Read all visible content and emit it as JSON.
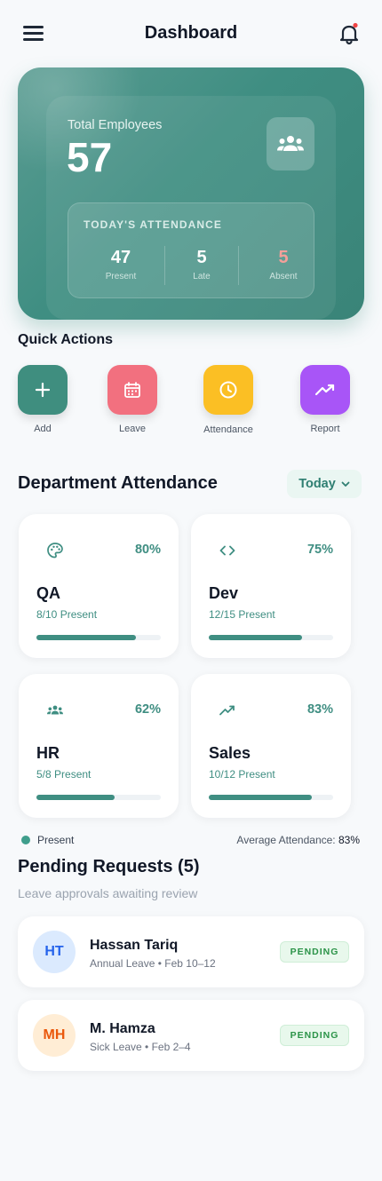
{
  "header": {
    "title": "Dashboard",
    "menu_icon": "hamburger-menu-icon",
    "bell_icon": "bell-icon",
    "notification_dot_color": "#ef4444"
  },
  "hero": {
    "total_label": "Total Employees",
    "total_value": "57",
    "icon": "group-icon",
    "attendance": {
      "title": "TODAY'S ATTENDANCE",
      "present": {
        "value": "47",
        "label": "Present"
      },
      "late": {
        "value": "5",
        "label": "Late"
      },
      "absent": {
        "value": "5",
        "label": "Absent",
        "color": "#f4a09a"
      }
    }
  },
  "quick_actions": {
    "title": "Quick Actions",
    "items": [
      {
        "label": "Add",
        "icon": "plus-icon",
        "color": "#3f8e7f"
      },
      {
        "label": "Leave",
        "icon": "calendar-icon",
        "color": "#f2707f"
      },
      {
        "label": "Attendance",
        "icon": "clock-icon",
        "color": "#fbbf24"
      },
      {
        "label": "Report",
        "icon": "trending-up-icon",
        "color": "#a855f7"
      }
    ]
  },
  "department": {
    "title": "Department Attendance",
    "filter_label": "Today",
    "cards": [
      {
        "name": "QA",
        "percent": "80%",
        "present_text": "8/10 Present",
        "ratio": 0.8,
        "icon": "palette-icon"
      },
      {
        "name": "Dev",
        "percent": "75%",
        "present_text": "12/15 Present",
        "ratio": 0.75,
        "icon": "code-icon"
      },
      {
        "name": "HR",
        "percent": "62%",
        "present_text": "5/8 Present",
        "ratio": 0.625,
        "icon": "group-icon"
      },
      {
        "name": "Sales",
        "percent": "83%",
        "present_text": "10/12 Present",
        "ratio": 0.83,
        "icon": "trending-up-icon"
      }
    ],
    "legend_label": "Present",
    "average_label": "Average Attendance:",
    "average_value": "83%"
  },
  "pending": {
    "title": "Pending Requests (5)",
    "subtitle": "Leave approvals awaiting review",
    "requests": [
      {
        "initials": "HT",
        "name": "Hassan Tariq",
        "detail": "Annual Leave • Feb 10–12",
        "status": "PENDING",
        "avatar_bg": "#dbeafe",
        "avatar_fg": "#2563eb"
      },
      {
        "initials": "MH",
        "name": "M. Hamza",
        "detail": "Sick Leave • Feb 2–4",
        "status": "PENDING",
        "avatar_bg": "#ffedd5",
        "avatar_fg": "#ea580c"
      }
    ]
  },
  "colors": {
    "primary": "#3f8e82",
    "background": "#f7f9fb"
  }
}
